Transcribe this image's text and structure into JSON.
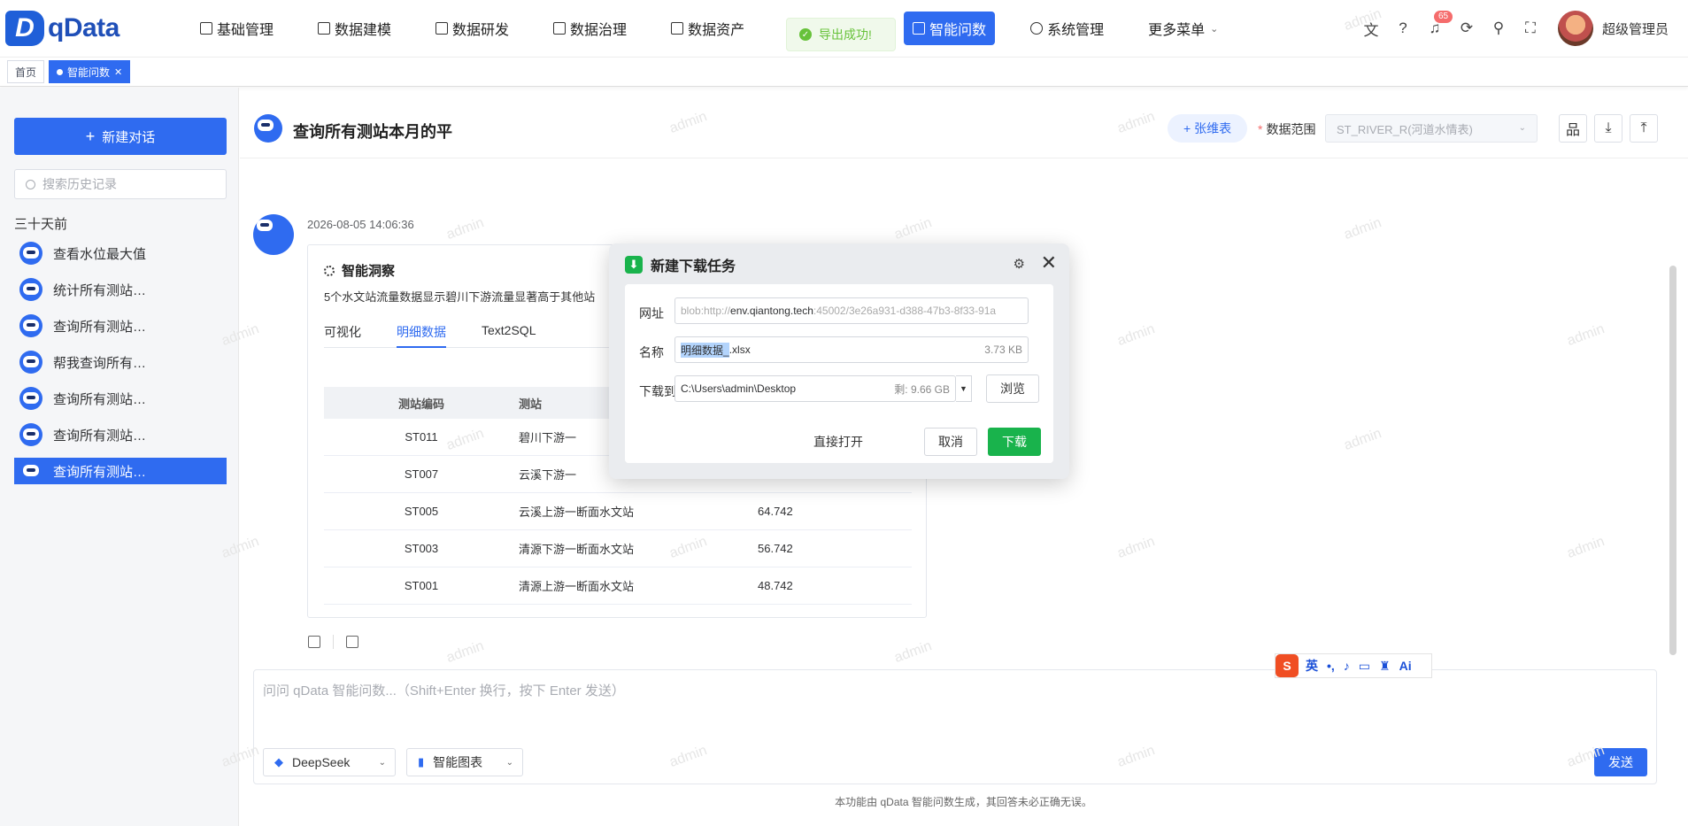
{
  "logo": {
    "mark": "D",
    "text": "qData"
  },
  "nav": {
    "items": [
      {
        "label": "基础管理"
      },
      {
        "label": "数据建模"
      },
      {
        "label": "数据研发"
      },
      {
        "label": "数据治理"
      },
      {
        "label": "数据资产"
      },
      {
        "label": "智能问数",
        "active": true
      },
      {
        "label": "系统管理"
      },
      {
        "label": "更多菜单"
      }
    ]
  },
  "toast": {
    "text": "导出成功!"
  },
  "top_right": {
    "badge": "65",
    "username": "超级管理员"
  },
  "tabs": [
    {
      "label": "首页"
    },
    {
      "label": "智能问数",
      "active": true
    }
  ],
  "sidebar": {
    "new_chat": "新建对话",
    "search_placeholder": "搜索历史记录",
    "group": "三十天前",
    "items": [
      {
        "label": "查看水位最大值"
      },
      {
        "label": "统计所有测站…"
      },
      {
        "label": "查询所有测站…"
      },
      {
        "label": "帮我查询所有…"
      },
      {
        "label": "查询所有测站…"
      },
      {
        "label": "查询所有测站…"
      },
      {
        "label": "查询所有测站…",
        "active": true
      }
    ]
  },
  "header": {
    "title": "查询所有测站本月的平",
    "tag_button": "+ 张维表",
    "range_label": "数据范围",
    "range_value": "ST_RIVER_R(河道水情表)"
  },
  "message": {
    "time": "2026-08-05 14:06:36",
    "insight_title": "智能洞察",
    "insight_text": "5个水文站流量数据显示碧川下游流量显著高于其他站",
    "tabs": [
      "可视化",
      "明细数据",
      "Text2SQL"
    ],
    "active_tab": 1,
    "columns": [
      "测站编码",
      "测站",
      ""
    ],
    "rows": [
      {
        "code": "ST011",
        "name": "碧川下游一",
        "value": ""
      },
      {
        "code": "ST007",
        "name": "云溪下游一",
        "value": ""
      },
      {
        "code": "ST005",
        "name": "云溪上游一断面水文站",
        "value": "64.742"
      },
      {
        "code": "ST003",
        "name": "清源下游一断面水文站",
        "value": "56.742"
      },
      {
        "code": "ST001",
        "name": "清源上游一断面水文站",
        "value": "48.742"
      }
    ]
  },
  "input": {
    "placeholder": "问问 qData 智能问数...（Shift+Enter 换行，按下 Enter 发送）",
    "model": "DeepSeek",
    "mode": "智能图表",
    "send": "发送"
  },
  "footnote": "本功能由 qData 智能问数生成，其回答未必正确无误。",
  "ime": {
    "lang": "英",
    "ai": "Ai"
  },
  "dialog": {
    "title": "新建下载任务",
    "url_label": "网址",
    "url_prefix": "blob:http://",
    "url_host": "env.qiantong.tech",
    "url_rest": ":45002/3e26a931-d388-47b3-8f33-91a",
    "name_label": "名称",
    "name_selected": "明细数据_",
    "name_ext": ".xlsx",
    "size": "3.73 KB",
    "dir_label": "下载到",
    "dir_value": "C:\\Users\\admin\\Desktop",
    "free": "剩: 9.66 GB",
    "browse": "浏览",
    "open": "直接打开",
    "cancel": "取消",
    "download": "下载"
  },
  "watermark": "admin",
  "colors": {
    "primary": "#2f6bf0",
    "success": "#19b34c",
    "danger": "#f56c6c"
  }
}
